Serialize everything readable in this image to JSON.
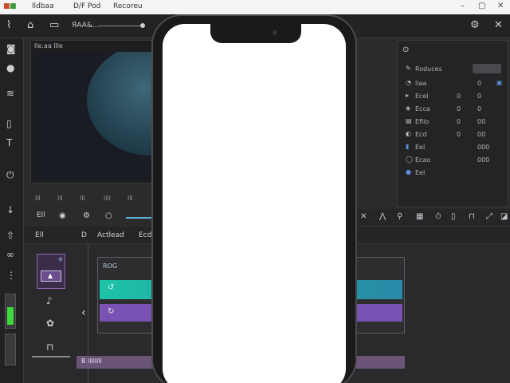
{
  "titlebar": {
    "app_label": "lldbaa",
    "file_label": "D/F Pod",
    "menu_label": "Recoreu"
  },
  "toolbar": {
    "project_label": "ЯAA&..."
  },
  "viewer": {
    "title": "lle.aa llle"
  },
  "controls": {
    "labels": [
      "lll",
      "lll",
      "lll",
      "llll",
      "lll"
    ]
  },
  "transport": {
    "left_label": "Ell"
  },
  "right_panel": {
    "header": "Roduces",
    "rows": [
      {
        "label": "llaa",
        "v1": "",
        "v2": "0"
      },
      {
        "label": "Ecel",
        "v1": "0",
        "v2": "0"
      },
      {
        "label": "Ecca",
        "v1": "0",
        "v2": "0"
      },
      {
        "label": "Efllo",
        "v1": "0",
        "v2": "00"
      },
      {
        "label": "Ecd",
        "v1": "0",
        "v2": "00"
      },
      {
        "label": "Eel",
        "v1": "",
        "v2": "000"
      },
      {
        "label": "Ecao",
        "v1": "",
        "v2": "000"
      },
      {
        "label": "Eel",
        "v1": "",
        "v2": ""
      }
    ]
  },
  "timeline": {
    "tab_edit": "Ell",
    "tab_d": "D",
    "tab_audio": "Actlead",
    "tab_e": "Ecd",
    "track_label": "ROG",
    "bottom_label": "B llllllll"
  },
  "colors": {
    "teal": "#1ec4a8",
    "purple": "#7a52b4",
    "level_green": "#3ddc3d"
  }
}
